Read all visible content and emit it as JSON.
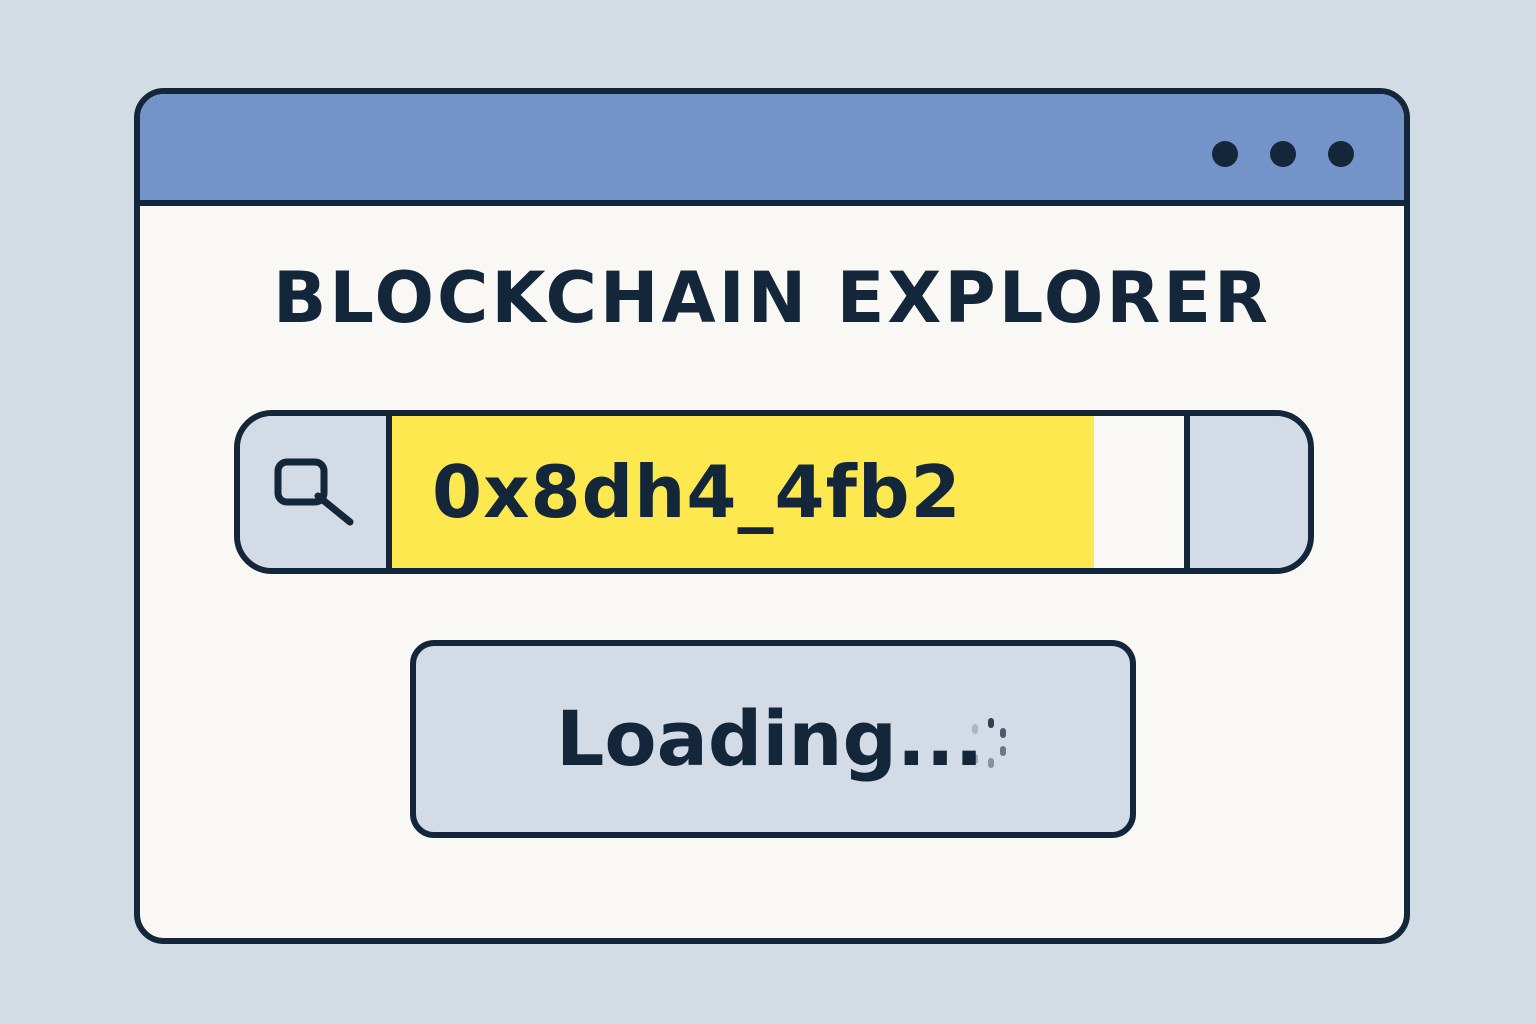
{
  "window": {
    "title_bar_color": "#7493c8",
    "controls": [
      "dot",
      "dot",
      "dot"
    ]
  },
  "page": {
    "title": "BLOCKCHAIN EXPLORER"
  },
  "search": {
    "icon": "search-icon",
    "value": "0x8dh4_4fb2",
    "highlight_color": "#fde94f"
  },
  "status_button": {
    "label": "Loading...",
    "icon": "spinner-icon"
  }
}
